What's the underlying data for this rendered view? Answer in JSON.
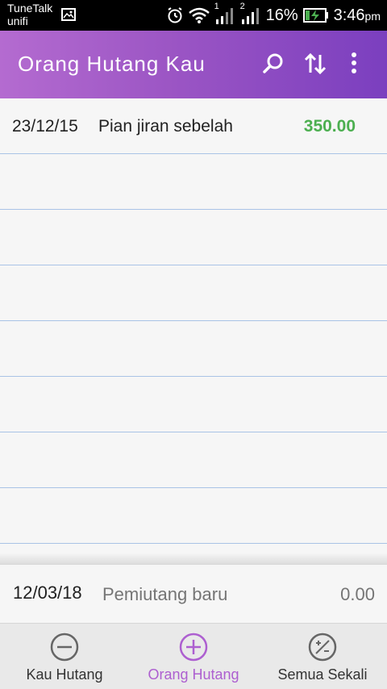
{
  "status_bar": {
    "carrier_line1": "TuneTalk",
    "carrier_line2": "unifi",
    "sim1": "1",
    "sim2": "2",
    "battery_percent": "16%",
    "time": "3:46",
    "time_suffix": "pm"
  },
  "app_bar": {
    "title": "Orang Hutang Kau",
    "icons": [
      "search-icon",
      "sort-icon",
      "more-vert-icon"
    ],
    "gradient": [
      "#b46bd0",
      "#7b3fbf"
    ]
  },
  "list": {
    "rows": [
      {
        "date": "23/12/15",
        "description": "Pian jiran sebelah",
        "amount": "350.00"
      },
      {
        "date": "",
        "description": "",
        "amount": ""
      },
      {
        "date": "",
        "description": "",
        "amount": ""
      },
      {
        "date": "",
        "description": "",
        "amount": ""
      },
      {
        "date": "",
        "description": "",
        "amount": ""
      },
      {
        "date": "",
        "description": "",
        "amount": ""
      },
      {
        "date": "",
        "description": "",
        "amount": ""
      },
      {
        "date": "",
        "description": "",
        "amount": ""
      }
    ],
    "amount_color": "#4caf50",
    "divider_color": "#a9c3e6"
  },
  "new_entry": {
    "date": "12/03/18",
    "description_placeholder": "Pemiutang baru",
    "amount_placeholder": "0.00"
  },
  "tabs": [
    {
      "label": "Kau Hutang",
      "icon": "minus-circle-icon",
      "active": false
    },
    {
      "label": "Orang Hutang",
      "icon": "plus-circle-icon",
      "active": true
    },
    {
      "label": "Semua Sekali",
      "icon": "percent-circle-icon",
      "active": false
    }
  ],
  "accent_color": "#ad5fd0"
}
